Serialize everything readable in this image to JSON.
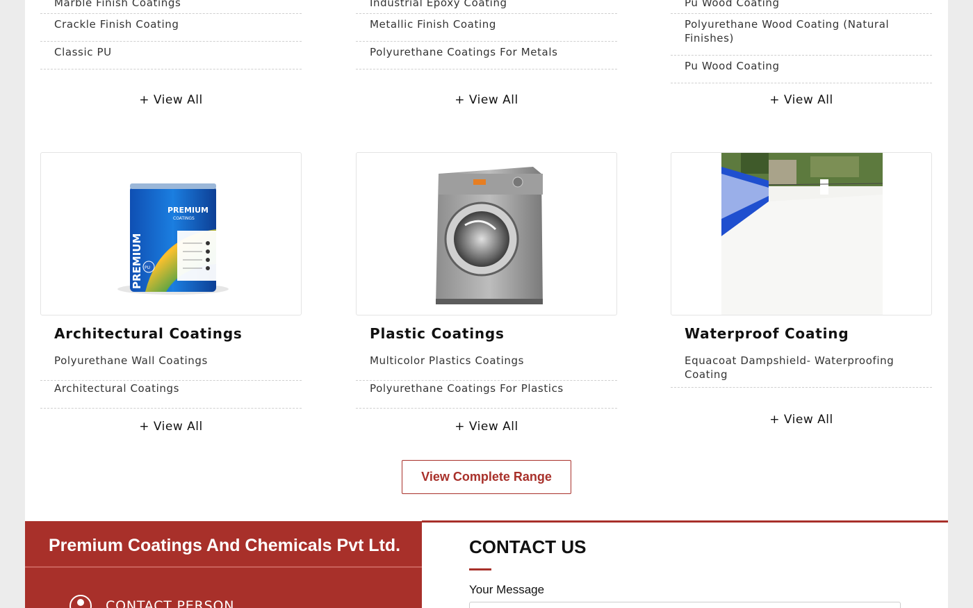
{
  "top_lists": [
    {
      "items": [
        "Marble Finish Coatings",
        "Crackle Finish Coating",
        "Classic PU"
      ],
      "view_all": "+ View All"
    },
    {
      "items": [
        "Industrial Epoxy Coating",
        "Metallic Finish Coating",
        "Polyurethane Coatings For Metals"
      ],
      "view_all": "+ View All"
    },
    {
      "items": [
        "Pu Wood Coating",
        "Polyurethane Wood Coating (Natural Finishes)",
        "Pu Wood Coating"
      ],
      "view_all": "+ View All"
    }
  ],
  "categories": [
    {
      "title": "Architectural Coatings",
      "image_icon": "paint-can-icon",
      "image_text": {
        "brand": "PREMIUM",
        "sub": "COATINGS",
        "side": "PREMIUM",
        "badge": "PU"
      },
      "items": [
        "Polyurethane Wall Coatings",
        "Architectural Coatings"
      ],
      "view_all": "+ View All"
    },
    {
      "title": "Plastic Coatings",
      "image_icon": "washing-machine-icon",
      "items": [
        "Multicolor Plastics Coatings",
        "Polyurethane Coatings For Plastics"
      ],
      "view_all": "+ View All"
    },
    {
      "title": "Waterproof Coating",
      "image_icon": "waterproofed-roof-photo",
      "items": [
        "Equacoat Dampshield- Waterproofing Coating"
      ],
      "view_all": "+ View All"
    }
  ],
  "range_button": "View Complete Range",
  "footer": {
    "company_name": "Premium Coatings And Chemicals Pvt Ltd.",
    "contact_person_label": "CONTACT PERSON",
    "contact_title": "CONTACT US",
    "message_label": "Your Message"
  },
  "colors": {
    "accent": "#a8302a",
    "page_background": "#ececec",
    "content_background": "#ffffff"
  }
}
